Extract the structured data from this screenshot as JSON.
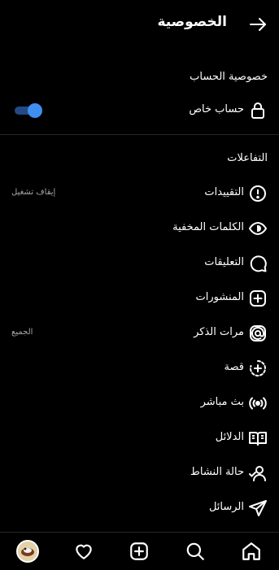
{
  "header": {
    "title": "الخصوصية",
    "back_icon": "arrow-right-icon"
  },
  "account_privacy": {
    "section_title": "خصوصية الحساب",
    "private_account": {
      "label": "حساب خاص",
      "icon": "lock-icon",
      "enabled": true
    }
  },
  "interactions": {
    "section_title": "التفاعلات",
    "items": [
      {
        "label": "التقييدات",
        "value": "إيقاف تشغيل",
        "icon": "restrict-icon"
      },
      {
        "label": "الكلمات المخفية",
        "value": "",
        "icon": "hidden-words-icon"
      },
      {
        "label": "التعليقات",
        "value": "",
        "icon": "comment-icon"
      },
      {
        "label": "المنشورات",
        "value": "",
        "icon": "post-add-icon"
      },
      {
        "label": "مرات الذكر",
        "value": "الجميع",
        "icon": "mention-icon"
      },
      {
        "label": "قصة",
        "value": "",
        "icon": "story-add-icon"
      },
      {
        "label": "بث مباشر",
        "value": "",
        "icon": "live-icon"
      },
      {
        "label": "الدلائل",
        "value": "",
        "icon": "guides-icon"
      },
      {
        "label": "حالة النشاط",
        "value": "",
        "icon": "activity-status-icon"
      },
      {
        "label": "الرسائل",
        "value": "",
        "icon": "send-icon"
      }
    ]
  },
  "tabbar": {
    "items": [
      "home-icon",
      "search-icon",
      "create-icon",
      "heart-icon",
      "profile-avatar"
    ]
  },
  "colors": {
    "background": "#000000",
    "toggle_on": "#3f8ff0",
    "secondary_text": "#a8a8a8",
    "divider": "#262626"
  }
}
